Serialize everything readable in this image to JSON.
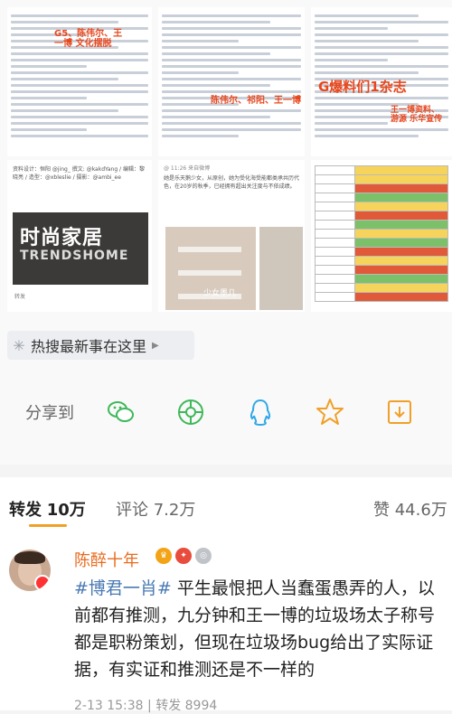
{
  "hot_search": {
    "label": "热搜最新事在这里"
  },
  "share": {
    "label": "分享到"
  },
  "images": {
    "t1_note": "G5、陈伟尔、王一博 文化摆脱",
    "t2_note": "陈伟尔、祁阳、王一博",
    "t3_note": "G爆料们1杂志",
    "t3_note2": "王一博资料、游源 乐华宣传",
    "t4_credits": "资料设计：恒阳 @jing_ 撰文: @kakdYang / 编辑：黎晓亮 / 造型：@xbleslie / 摄影：@ambi_ee",
    "t4_cover_title": "时尚家居",
    "t4_cover_sub": "TRENDSHOME",
    "t4_share": "转发",
    "t5_head": "@ 11:26 来自微博",
    "t5_text": "她是乐天鹅少女，从原创，她为受化海受能都类承共历代色，在20岁的秋季，已经拥有超出关注度与不依成绩。",
    "t5_room": "少女墨几"
  },
  "tabs": {
    "repost_label": "转发",
    "repost_count": "10万",
    "comment_label": "评论",
    "comment_count": "7.2万",
    "like_label": "赞",
    "like_count": "44.6万"
  },
  "comment": {
    "username": "陈醉十年",
    "hashtag": "#博君一肖#",
    "text": "平生最恨把人当蠢蛋愚弄的人，以前都有推测，九分钟和王一博的垃圾场太子称号都是职粉策划，但现在垃圾场bug给出了实际证据，有实证和推测还是不一样的",
    "time": "2-13 15:38",
    "repost_meta": "转发 8994"
  },
  "colors": {
    "accent": "#e86b1f",
    "link": "#4a7ab4",
    "tab_underline": "#f0a028"
  }
}
